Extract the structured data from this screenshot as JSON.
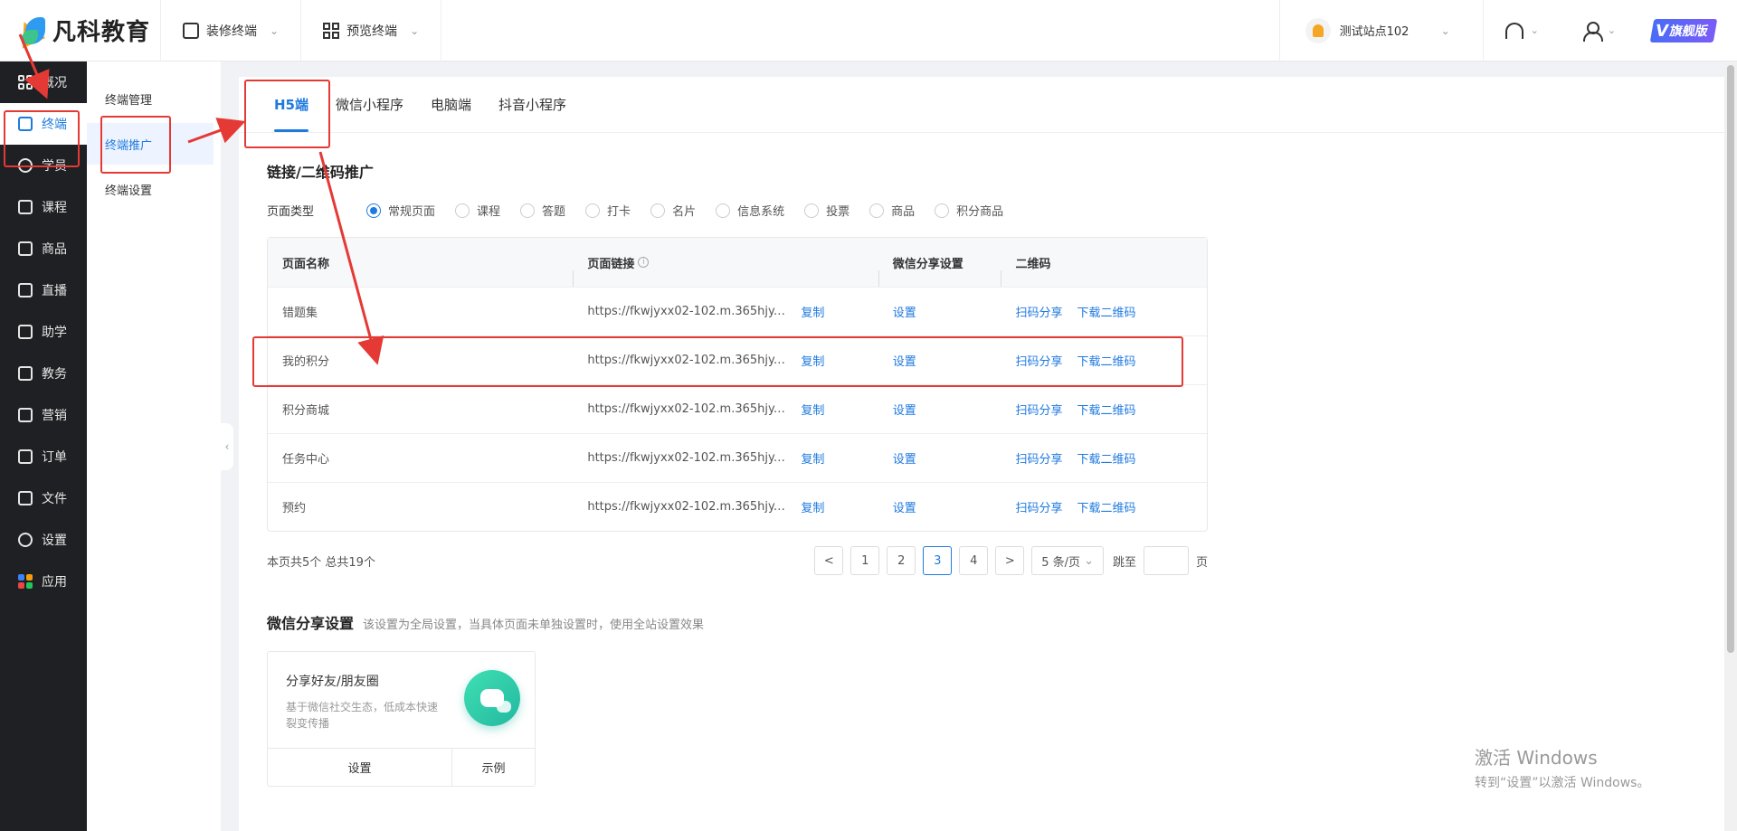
{
  "brand": {
    "name": "凡科教育"
  },
  "topbar": {
    "decorate": "装修终端",
    "preview": "预览终端",
    "site": "测试站点102",
    "edition": "旗舰版",
    "edition_mark": "V"
  },
  "sidebar": {
    "items": [
      {
        "label": "概况",
        "icon": "overview-grid-icon"
      },
      {
        "label": "终端",
        "icon": "store-icon"
      },
      {
        "label": "学员",
        "icon": "users-icon"
      },
      {
        "label": "课程",
        "icon": "course-icon"
      },
      {
        "label": "商品",
        "icon": "bag-icon"
      },
      {
        "label": "直播",
        "icon": "live-icon"
      },
      {
        "label": "助学",
        "icon": "assist-icon"
      },
      {
        "label": "教务",
        "icon": "academic-icon"
      },
      {
        "label": "营销",
        "icon": "marketing-icon"
      },
      {
        "label": "订单",
        "icon": "order-icon"
      },
      {
        "label": "文件",
        "icon": "folder-icon"
      },
      {
        "label": "设置",
        "icon": "settings-icon"
      },
      {
        "label": "应用",
        "icon": "apps-icon"
      }
    ],
    "active": "终端"
  },
  "subnav": {
    "items": [
      "终端管理",
      "终端推广",
      "终端设置"
    ],
    "active": "终端推广"
  },
  "tabs": [
    "H5端",
    "微信小程序",
    "电脑端",
    "抖音小程序"
  ],
  "section": {
    "title": "链接/二维码推广",
    "page_type_label": "页面类型",
    "page_types": [
      "常规页面",
      "课程",
      "答题",
      "打卡",
      "名片",
      "信息系统",
      "投票",
      "商品",
      "积分商品"
    ]
  },
  "table": {
    "headers": [
      "页面名称",
      "页面链接",
      "微信分享设置",
      "二维码"
    ],
    "copy_label": "复制",
    "setting_label": "设置",
    "scan_label": "扫码分享",
    "download_label": "下载二维码",
    "rows": [
      {
        "name": "错题集",
        "url": "https://fkwjyxx02-102.m.365hjy.co..."
      },
      {
        "name": "我的积分",
        "url": "https://fkwjyxx02-102.m.365hjy.co..."
      },
      {
        "name": "积分商城",
        "url": "https://fkwjyxx02-102.m.365hjy.co..."
      },
      {
        "name": "任务中心",
        "url": "https://fkwjyxx02-102.m.365hjy.co..."
      },
      {
        "name": "预约",
        "url": "https://fkwjyxx02-102.m.365hjy.co..."
      }
    ]
  },
  "pagination": {
    "summary": "本页共5个 总共19个",
    "pages": [
      "1",
      "2",
      "3",
      "4"
    ],
    "current": "3",
    "prev": "<",
    "next": ">",
    "page_size": "5 条/页",
    "jump_label": "跳至",
    "page_unit": "页"
  },
  "share": {
    "title": "微信分享设置",
    "desc": "该设置为全局设置，当具体页面未单独设置时，使用全站设置效果",
    "card_title": "分享好友/朋友圈",
    "card_desc": "基于微信社交生态，低成本快速裂变传播",
    "setting": "设置",
    "example": "示例"
  },
  "watermark": {
    "line1": "激活 Windows",
    "line2": "转到“设置”以激活 Windows。"
  }
}
